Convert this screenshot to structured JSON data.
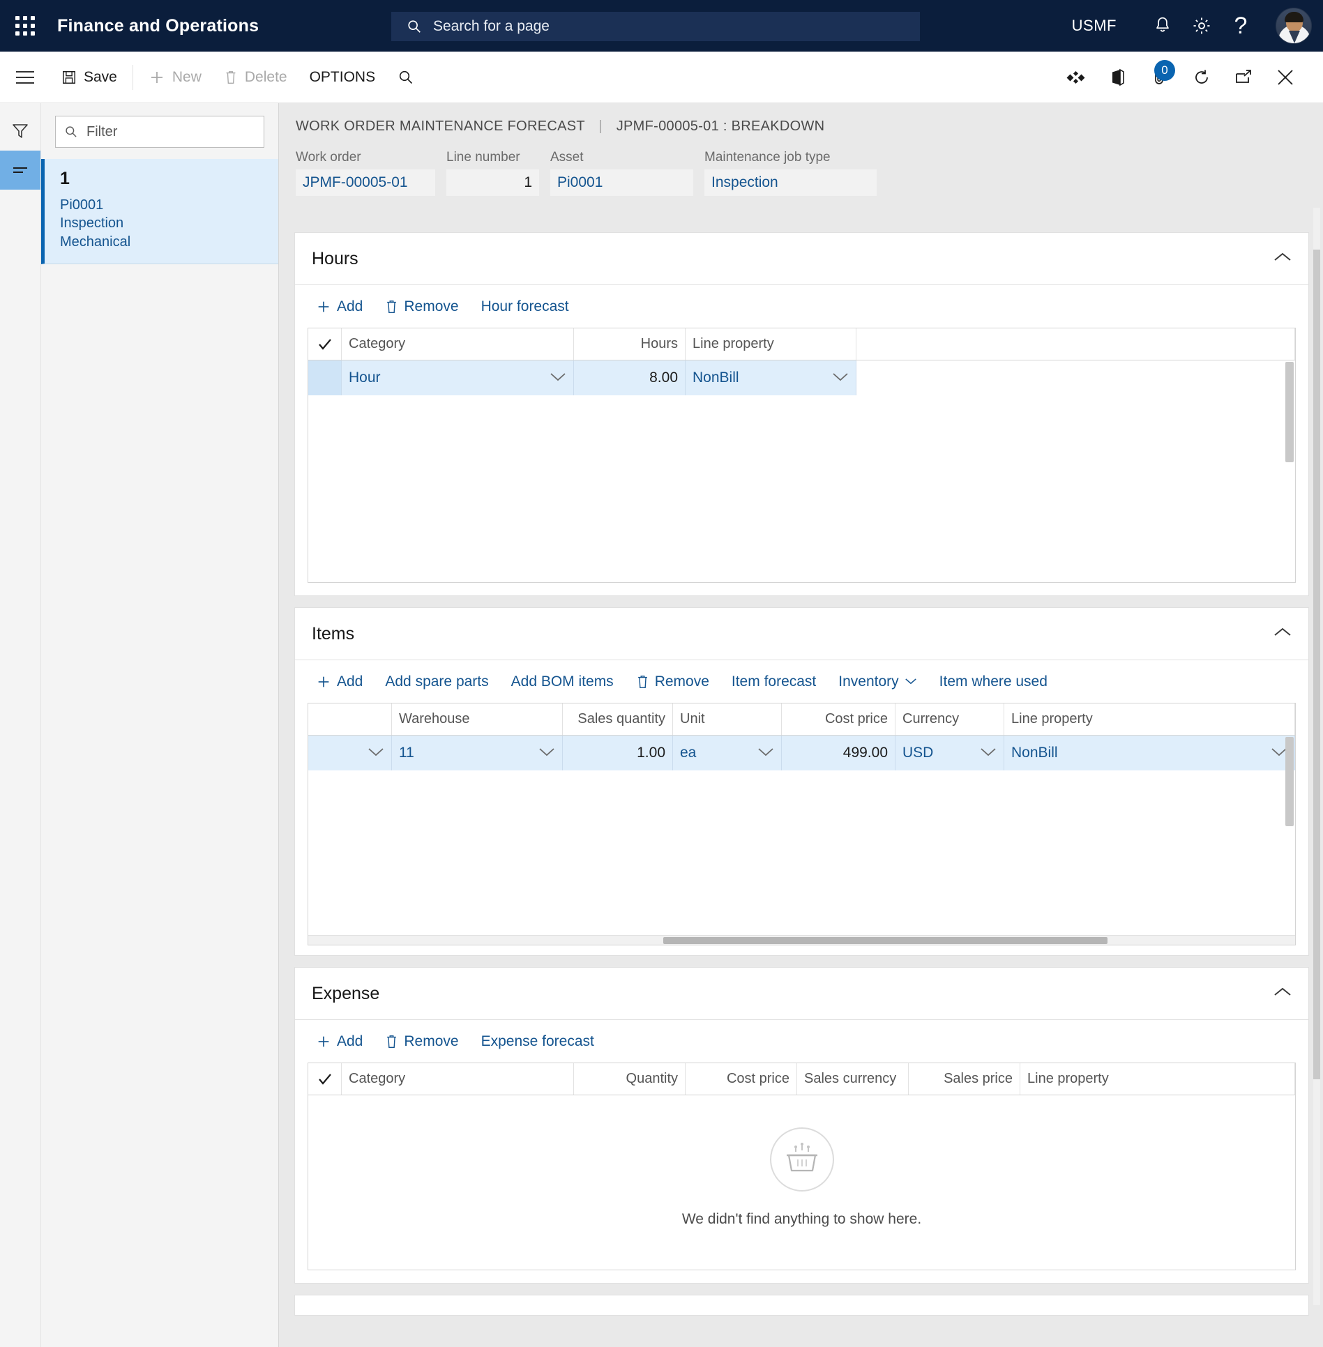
{
  "topnav": {
    "waffle_label": "app-launcher",
    "app_title": "Finance and Operations",
    "search_placeholder": "Search for a page",
    "company": "USMF",
    "icons": [
      "notifications-bell-icon",
      "settings-gear-icon",
      "help-question-icon",
      "user-avatar"
    ]
  },
  "actionpane": {
    "save_label": "Save",
    "new_label": "New",
    "delete_label": "Delete",
    "options_label": "OPTIONS",
    "search_icon": "search-icon",
    "right_icons": [
      "share-icon",
      "office-icon",
      "attachment-icon",
      "refresh-icon",
      "popout-icon",
      "close-icon"
    ],
    "attachment_badge": "0"
  },
  "navpane": {
    "filter_placeholder": "Filter",
    "record": {
      "number": "1",
      "asset": "Pi0001",
      "job_type": "Inspection",
      "trade": "Mechanical"
    }
  },
  "breadcrumb": {
    "page": "WORK ORDER MAINTENANCE FORECAST",
    "separator": "|",
    "record": "JPMF-00005-01 : BREAKDOWN"
  },
  "header_fields": [
    {
      "label": "Work order",
      "value": "JPMF-00005-01",
      "align": "left"
    },
    {
      "label": "Line number",
      "value": "1",
      "align": "right"
    },
    {
      "label": "Asset",
      "value": "Pi0001",
      "align": "left"
    },
    {
      "label": "Maintenance job type",
      "value": "Inspection",
      "align": "left"
    }
  ],
  "sections": {
    "hours": {
      "title": "Hours",
      "toolbar": [
        {
          "label": "Add",
          "icon": "plus-icon"
        },
        {
          "label": "Remove",
          "icon": "trash-icon"
        },
        {
          "label": "Hour forecast",
          "icon": "none"
        }
      ],
      "columns": [
        "",
        "Category",
        "Hours",
        "Line property",
        ""
      ],
      "rows": [
        {
          "check": "",
          "category": "Hour",
          "hours": "8.00",
          "line_property": "NonBill"
        }
      ]
    },
    "items": {
      "title": "Items",
      "toolbar": [
        {
          "label": "Add",
          "icon": "plus-icon"
        },
        {
          "label": "Add spare parts",
          "icon": "none"
        },
        {
          "label": "Add BOM items",
          "icon": "none"
        },
        {
          "label": "Remove",
          "icon": "trash-icon"
        },
        {
          "label": "Item forecast",
          "icon": "none"
        },
        {
          "label": "Inventory",
          "icon": "chevron-down-icon"
        },
        {
          "label": "Item where used",
          "icon": "none"
        }
      ],
      "columns": [
        "",
        "Warehouse",
        "Sales quantity",
        "Unit",
        "Cost price",
        "Currency",
        "Line property"
      ],
      "rows": [
        {
          "first": "",
          "warehouse": "11",
          "sales_quantity": "1.00",
          "unit": "ea",
          "cost_price": "499.00",
          "currency": "USD",
          "line_property": "NonBill"
        }
      ]
    },
    "expense": {
      "title": "Expense",
      "toolbar": [
        {
          "label": "Add",
          "icon": "plus-icon"
        },
        {
          "label": "Remove",
          "icon": "trash-icon"
        },
        {
          "label": "Expense forecast",
          "icon": "none"
        }
      ],
      "columns": [
        "",
        "Category",
        "Quantity",
        "Cost price",
        "Sales currency",
        "Sales price",
        "Line property"
      ],
      "rows": [],
      "empty_message": "We didn't find anything to show here.",
      "empty_icon": "empty-basket-icon"
    }
  },
  "colors": {
    "nav_background": "#0b1e3c",
    "accent_link": "#14548f",
    "row_selected": "#dfeefb",
    "rail_active": "#71afe5"
  }
}
